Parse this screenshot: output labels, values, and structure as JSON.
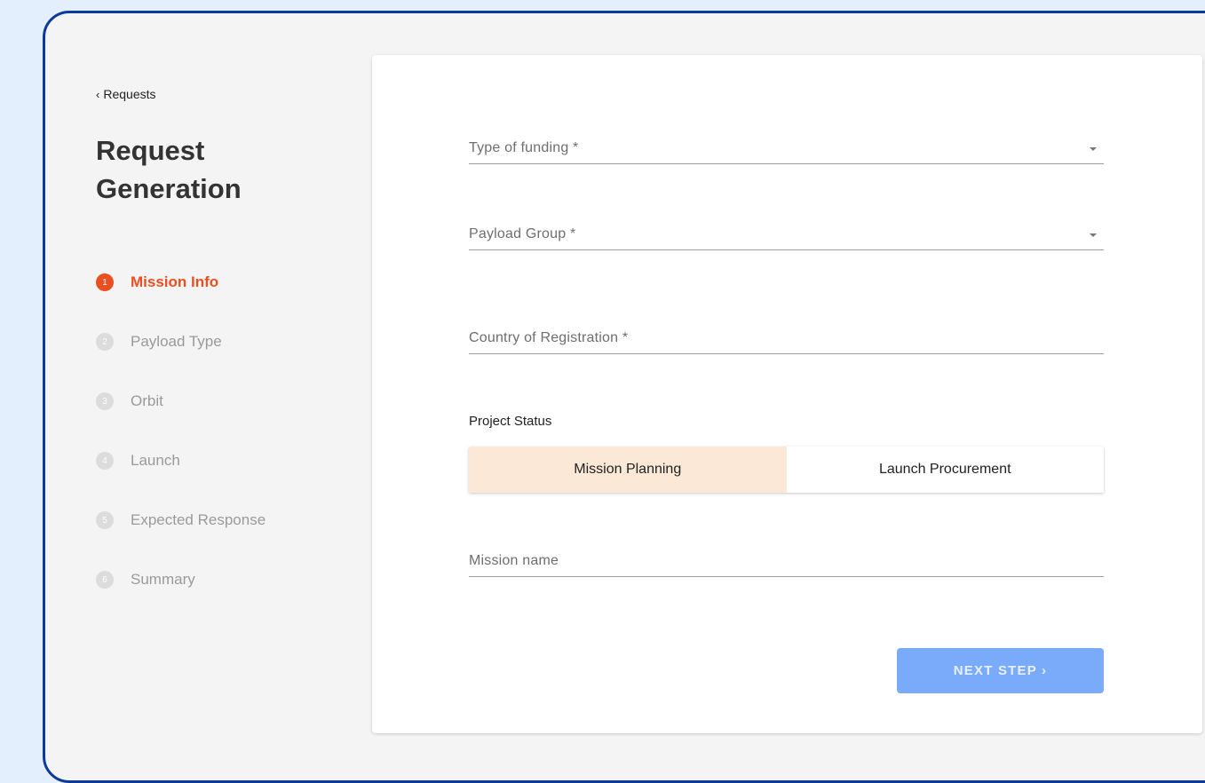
{
  "nav": {
    "back_label": "Requests",
    "back_chevron": "‹"
  },
  "page": {
    "title": "Request Generation"
  },
  "steps": [
    {
      "number": "1",
      "label": "Mission Info",
      "active": true
    },
    {
      "number": "2",
      "label": "Payload Type",
      "active": false
    },
    {
      "number": "3",
      "label": "Orbit",
      "active": false
    },
    {
      "number": "4",
      "label": "Launch",
      "active": false
    },
    {
      "number": "5",
      "label": "Expected Response",
      "active": false
    },
    {
      "number": "6",
      "label": "Summary",
      "active": false
    }
  ],
  "form": {
    "funding_type": {
      "label": "Type of funding *",
      "value": ""
    },
    "payload_group": {
      "label": "Payload Group *",
      "value": ""
    },
    "country": {
      "label": "Country of Registration *",
      "value": ""
    },
    "project_status": {
      "label": "Project Status",
      "options": [
        "Mission Planning",
        "Launch Procurement"
      ],
      "selected": "Mission Planning"
    },
    "mission_name": {
      "label": "Mission name",
      "value": ""
    },
    "next_button": "NEXT STEP ›"
  },
  "colors": {
    "accent": "#ea4f22",
    "border": "#0b3a9c",
    "button": "#7aabfb",
    "selected_toggle": "#fce8d6"
  }
}
